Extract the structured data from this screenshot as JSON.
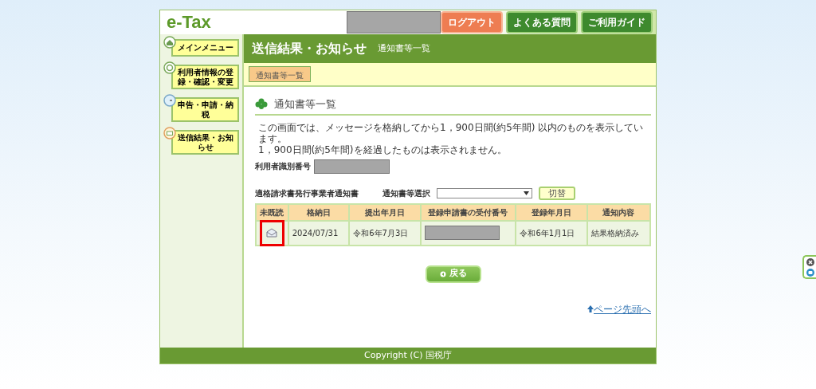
{
  "header": {
    "logo": "e-Tax",
    "buttons": [
      {
        "label": "ログアウト",
        "kind": "logout"
      },
      {
        "label": "よくある質問",
        "kind": "nav"
      },
      {
        "label": "ご利用ガイド",
        "kind": "nav"
      }
    ]
  },
  "sidebar": {
    "items": [
      {
        "label": "メインメニュー"
      },
      {
        "label": "利用者情報の登録・確認・変更"
      },
      {
        "label": "申告・申請・納税"
      },
      {
        "label": "送信結果・お知らせ"
      }
    ]
  },
  "page_header": {
    "title": "送信結果・お知らせ",
    "subtitle": "通知書等一覧"
  },
  "tabs": [
    {
      "label": "通知書等一覧",
      "selected": true
    }
  ],
  "section": {
    "title": "通知書等一覧",
    "notes": [
      "この画面では、メッセージを格納してから1，900日間(約5年間) 以内のものを表示しています。",
      "1，900日間(約5年間)を経過したものは表示されません。"
    ],
    "user_id_label": "利用者識別番号"
  },
  "filter": {
    "notice_type": "適格請求書発行事業者通知書",
    "select_label": "通知書等選択",
    "button": "切替"
  },
  "table": {
    "columns": [
      "未既読",
      "格納日",
      "提出年月日",
      "登録申請書の受付番号",
      "登録年月日",
      "通知内容"
    ],
    "rows": [
      {
        "read": true,
        "highlighted": true,
        "stored_date": "2024/07/31",
        "submitted_date": "令和6年7月3日",
        "registered_date": "令和6年1月1日",
        "content": "結果格納済み"
      }
    ]
  },
  "back_button": "戻る",
  "page_top_link": "ページ先頭へ",
  "footer": "Copyright (C) 国税庁"
}
